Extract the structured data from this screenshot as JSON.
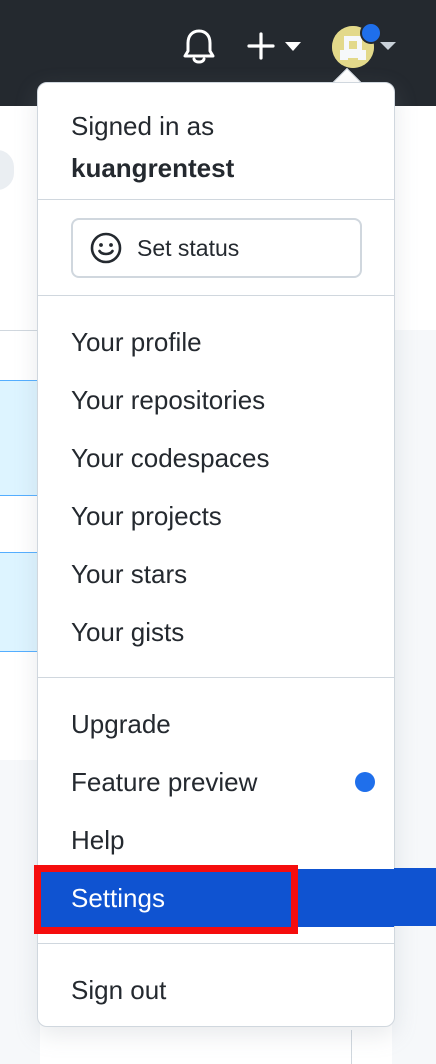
{
  "header": {
    "bell_icon": "bell-icon",
    "create_icon": "plus-icon",
    "avatar_icon": "avatar-icon"
  },
  "dropdown": {
    "signed_in_label": "Signed in as",
    "username": "kuangrentest",
    "set_status_label": "Set status",
    "items": [
      {
        "label": "Your profile"
      },
      {
        "label": "Your repositories"
      },
      {
        "label": "Your codespaces"
      },
      {
        "label": "Your projects"
      },
      {
        "label": "Your stars"
      },
      {
        "label": "Your gists"
      }
    ],
    "secondary_items": [
      {
        "label": "Upgrade"
      },
      {
        "label": "Feature preview"
      },
      {
        "label": "Help"
      },
      {
        "label": "Settings",
        "active": true
      }
    ],
    "sign_out_label": "Sign out"
  },
  "colors": {
    "header_bg": "#24292f",
    "accent_blue": "#1f6feb",
    "active_item_bg": "#0f53d1",
    "highlight_red": "#f50d0d"
  }
}
